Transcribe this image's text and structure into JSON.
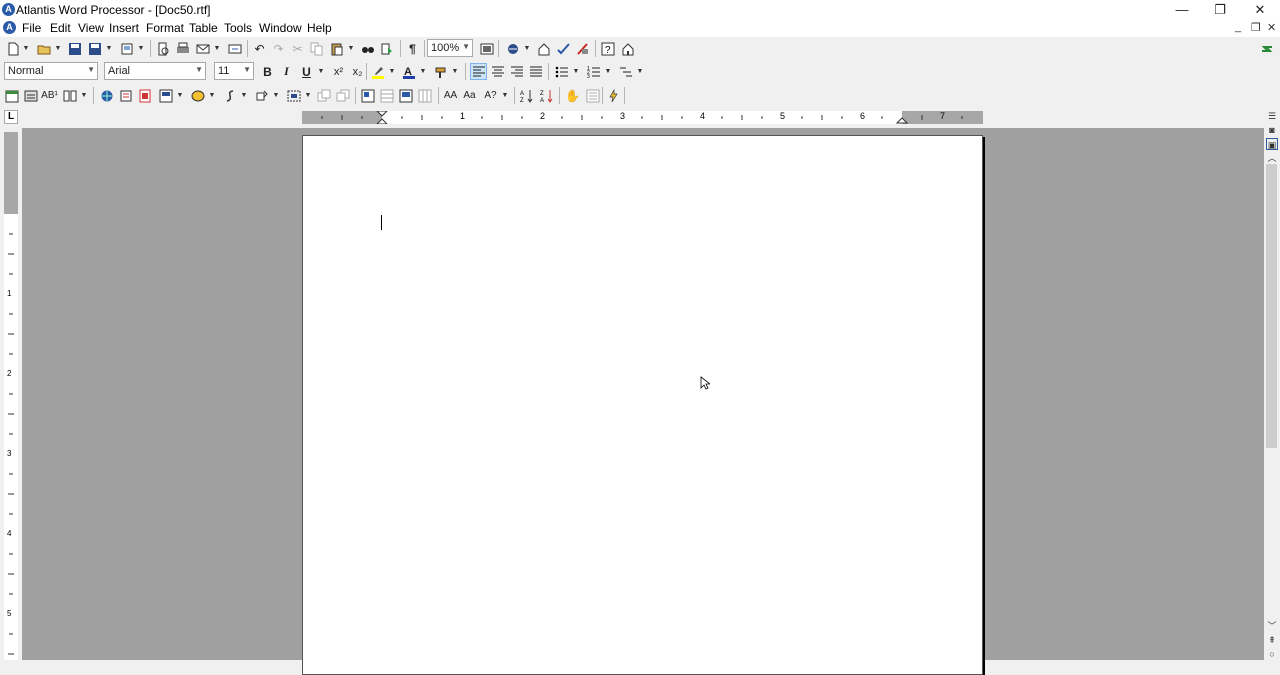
{
  "window": {
    "title": "Atlantis Word Processor - [Doc50.rtf]",
    "minimize": "—",
    "maximize": "❐",
    "close": "✕"
  },
  "menu": {
    "items": [
      "File",
      "Edit",
      "View",
      "Insert",
      "Format",
      "Table",
      "Tools",
      "Window",
      "Help"
    ],
    "mdi_minimize": "_",
    "mdi_restore": "❐",
    "mdi_close": "✕"
  },
  "format_bar": {
    "style": "Normal",
    "font": "Arial",
    "size": "11"
  },
  "zoom": "100%",
  "ruler": {
    "corner": "L",
    "h_numbers": [
      "1",
      "2",
      "3",
      "4",
      "5",
      "6",
      "7"
    ],
    "v_numbers": [
      "1",
      "2",
      "3",
      "4",
      "5"
    ]
  },
  "colors": {
    "highlight": "#ffff00",
    "font_color": "#1f3ea8",
    "accent": "#2b5aa8"
  }
}
